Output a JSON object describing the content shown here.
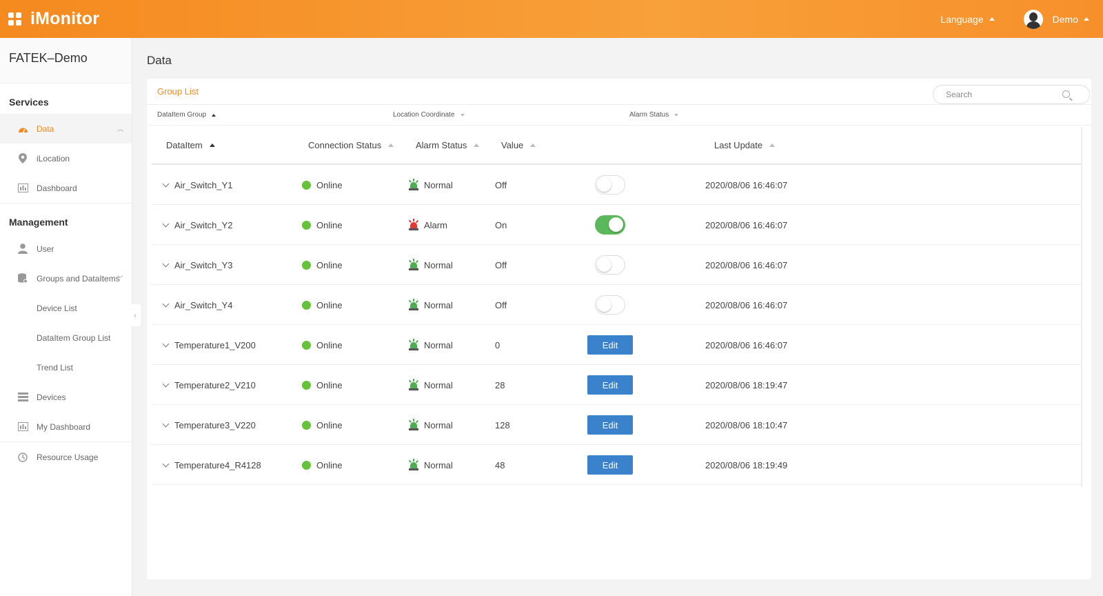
{
  "header": {
    "app_title": "iMonitor",
    "language_label": "Language",
    "user_name": "Demo"
  },
  "sidebar": {
    "org_name": "FATEK–Demo",
    "services_title": "Services",
    "services": [
      {
        "label": "Data",
        "icon": "dashboard-gauge-icon",
        "active": true
      },
      {
        "label": "iLocation",
        "icon": "location-pin-icon"
      },
      {
        "label": "Dashboard",
        "icon": "dashboard-panel-icon"
      }
    ],
    "management_title": "Management",
    "management": [
      {
        "label": "User",
        "icon": "user-icon"
      },
      {
        "label": "Groups and DataItems",
        "icon": "database-icon"
      },
      {
        "label": "Device List"
      },
      {
        "label": "DataItem Group List"
      },
      {
        "label": "Trend List"
      },
      {
        "label": "Devices",
        "icon": "server-list-icon"
      },
      {
        "label": "My Dashboard",
        "icon": "dashboard-panel-icon"
      }
    ],
    "resource_usage": "Resource Usage"
  },
  "main": {
    "page_title": "Data",
    "card_title": "Group List",
    "search_placeholder": "Search",
    "filters": {
      "group": "DataItem Group",
      "location": "Location Coordinate",
      "alarm": "Alarm Status"
    },
    "columns": {
      "dataitem": "DataItem",
      "connection": "Connection Status",
      "alarm": "Alarm Status",
      "value": "Value",
      "last_update": "Last Update"
    },
    "edit_label": "Edit",
    "colors": {
      "accent": "#f5891f",
      "online": "#66c13b",
      "alarm_normal": "#4caf50",
      "alarm_red": "#e53935",
      "button_blue": "#3b82cc"
    },
    "rows": [
      {
        "name": "Air_Switch_Y1",
        "connection": "Online",
        "alarm": "Normal",
        "value": "Off",
        "control": "toggle-off",
        "last_update": "2020/08/06 16:46:07"
      },
      {
        "name": "Air_Switch_Y2",
        "connection": "Online",
        "alarm": "Alarm",
        "value": "On",
        "control": "toggle-on",
        "last_update": "2020/08/06 16:46:07"
      },
      {
        "name": "Air_Switch_Y3",
        "connection": "Online",
        "alarm": "Normal",
        "value": "Off",
        "control": "toggle-off",
        "last_update": "2020/08/06 16:46:07"
      },
      {
        "name": "Air_Switch_Y4",
        "connection": "Online",
        "alarm": "Normal",
        "value": "Off",
        "control": "toggle-off",
        "last_update": "2020/08/06 16:46:07"
      },
      {
        "name": "Temperature1_V200",
        "connection": "Online",
        "alarm": "Normal",
        "value": "0",
        "control": "edit",
        "last_update": "2020/08/06 16:46:07"
      },
      {
        "name": "Temperature2_V210",
        "connection": "Online",
        "alarm": "Normal",
        "value": "28",
        "control": "edit",
        "last_update": "2020/08/06 18:19:47"
      },
      {
        "name": "Temperature3_V220",
        "connection": "Online",
        "alarm": "Normal",
        "value": "128",
        "control": "edit",
        "last_update": "2020/08/06 18:10:47"
      },
      {
        "name": "Temperature4_R4128",
        "connection": "Online",
        "alarm": "Normal",
        "value": "48",
        "control": "edit",
        "last_update": "2020/08/06 18:19:49"
      }
    ]
  }
}
